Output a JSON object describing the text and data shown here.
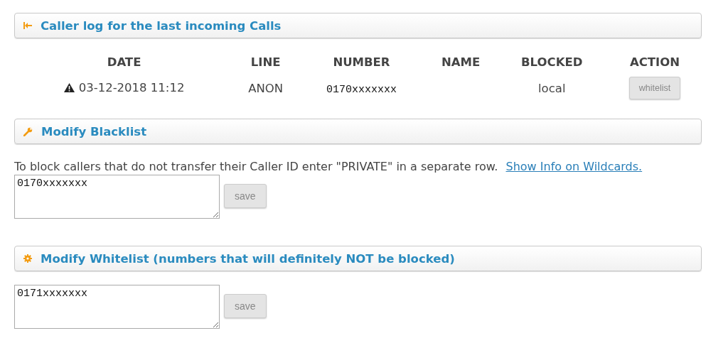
{
  "caller_log": {
    "title": "Caller log for the last incoming Calls",
    "columns": [
      "DATE",
      "LINE",
      "NUMBER",
      "NAME",
      "BLOCKED",
      "ACTION"
    ],
    "rows": [
      {
        "warning": true,
        "date": "03-12-2018 11:12",
        "line": "ANON",
        "number": "0170xxxxxxx",
        "name": "",
        "blocked": "local",
        "action": {
          "label": "whitelist",
          "disabled": true
        }
      }
    ]
  },
  "blacklist": {
    "title": "Modify Blacklist",
    "description": "To block callers that do not transfer their Caller ID enter \"PRIVATE\" in a separate row.",
    "link": "Show Info on Wildcards.",
    "value": "0170xxxxxxx",
    "save": {
      "label": "save",
      "disabled": true
    }
  },
  "whitelist": {
    "title": "Modify Whitelist (numbers that will definitely NOT be blocked)",
    "value": "0171xxxxxxx",
    "save": {
      "label": "save",
      "disabled": true
    }
  }
}
